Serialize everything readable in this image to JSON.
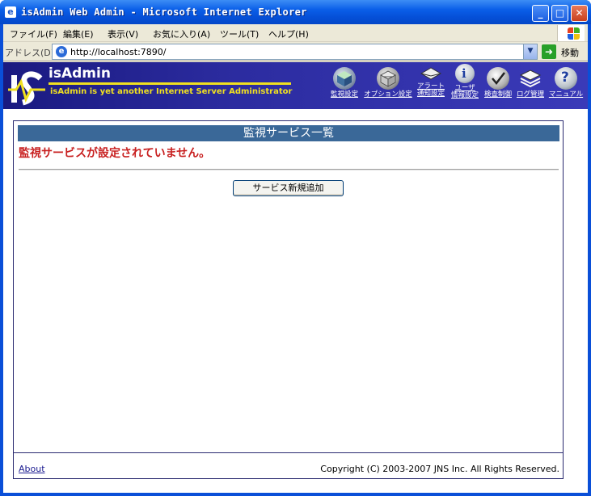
{
  "window": {
    "title": "isAdmin Web Admin - Microsoft Internet Explorer",
    "controls": {
      "minimize": "_",
      "maximize": "□",
      "close": "✕"
    }
  },
  "menubar": {
    "items": [
      "ファイル(F)",
      "編集(E)",
      "表示(V)",
      "お気に入り(A)",
      "ツール(T)",
      "ヘルプ(H)"
    ]
  },
  "addressbar": {
    "label": "アドレス(D)",
    "url": "http://localhost:7890/",
    "go_label": "移動"
  },
  "header": {
    "app_name": "isAdmin",
    "tagline": "isAdmin is yet another Internet Server Administrator",
    "nav": [
      {
        "label": "監視設定",
        "icon": "cube-icon"
      },
      {
        "label": "オプション設定",
        "icon": "gears-icon"
      },
      {
        "label": "アラート通知設定",
        "label_top": "アラート",
        "label_bottom": "通知設定",
        "icon": "alert-envelope-icon"
      },
      {
        "label": "ユーザ情報設定",
        "label_top": "ユーザ",
        "label_bottom": "情報設定",
        "icon": "info-icon"
      },
      {
        "label": "検査制御",
        "icon": "check-icon"
      },
      {
        "label": "ログ管理",
        "icon": "log-stack-icon"
      },
      {
        "label": "マニュアル",
        "icon": "help-icon"
      }
    ]
  },
  "main": {
    "title": "監視サービス一覧",
    "message": "監視サービスが設定されていません。",
    "add_button": "サービス新規追加"
  },
  "footer": {
    "about": "About",
    "copyright": "Copyright (C) 2003-2007 JNS Inc. All Rights Reserved."
  },
  "colors": {
    "title_bar": "#0550d8",
    "header_bg": "#2c2ca0",
    "accent_yellow": "#f0e020",
    "section_title_bg": "#3a6898",
    "warning_red": "#c82020"
  }
}
